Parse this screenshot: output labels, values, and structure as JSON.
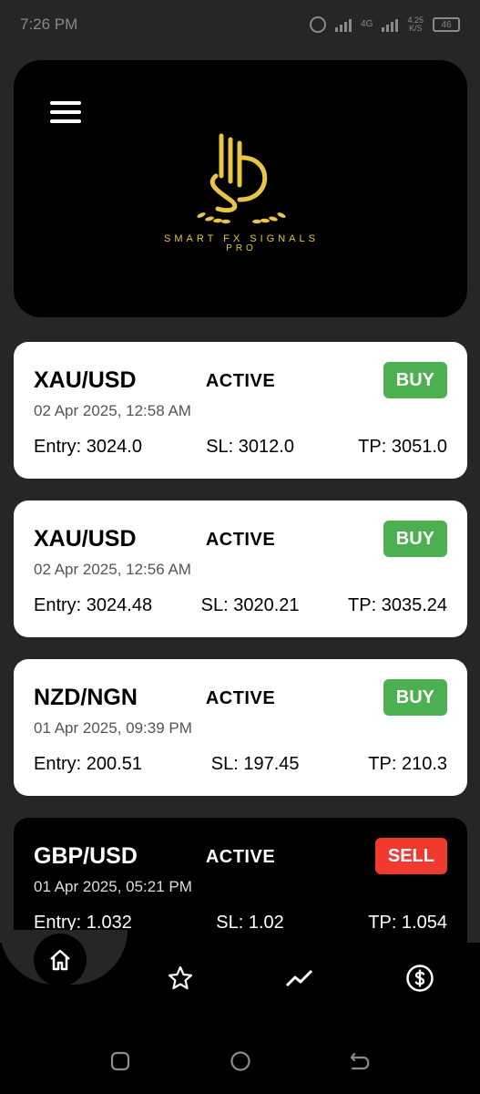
{
  "status_bar": {
    "time": "7:26 PM",
    "network": "4G",
    "speed_value": "4.25",
    "speed_unit": "K/S",
    "battery": "46"
  },
  "header": {
    "logo_text": "SMART FX SIGNALS",
    "logo_subtext": "PRO"
  },
  "signals": [
    {
      "pair": "XAU/USD",
      "status": "ACTIVE",
      "action": "BUY",
      "date": "02 Apr 2025, 12:58 AM",
      "entry": "Entry: 3024.0",
      "sl": "SL: 3012.0",
      "tp": "TP: 3051.0"
    },
    {
      "pair": "XAU/USD",
      "status": "ACTIVE",
      "action": "BUY",
      "date": "02 Apr 2025, 12:56 AM",
      "entry": "Entry: 3024.48",
      "sl": "SL: 3020.21",
      "tp": "TP: 3035.24"
    },
    {
      "pair": "NZD/NGN",
      "status": "ACTIVE",
      "action": "BUY",
      "date": "01 Apr 2025, 09:39 PM",
      "entry": "Entry: 200.51",
      "sl": "SL: 197.45",
      "tp": "TP: 210.3"
    },
    {
      "pair": "GBP/USD",
      "status": "ACTIVE",
      "action": "SELL",
      "date": "01 Apr 2025, 05:21 PM",
      "entry": "Entry: 1.032",
      "sl": "SL: 1.02",
      "tp": "TP: 1.054"
    }
  ],
  "nav": {
    "items": [
      "home-icon",
      "star-icon",
      "trend-icon",
      "dollar-icon"
    ]
  },
  "colors": {
    "background": "#262626",
    "buy": "#4caf50",
    "sell": "#f03a30",
    "gold": "#e8c547"
  }
}
